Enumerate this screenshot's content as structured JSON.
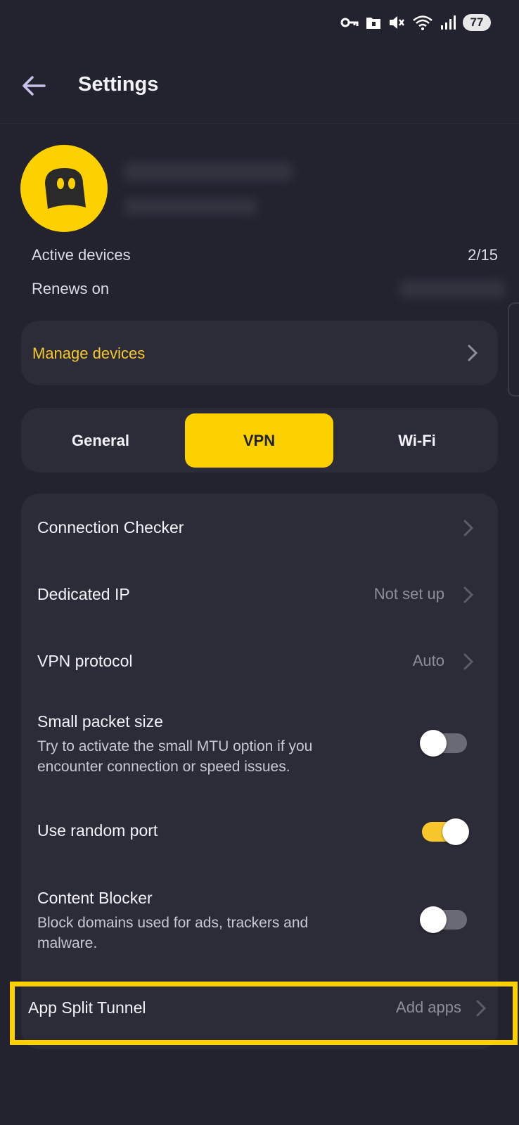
{
  "status_bar": {
    "battery": "77"
  },
  "app_bar": {
    "title": "Settings"
  },
  "account": {
    "active_devices_label": "Active devices",
    "active_devices_value": "2/15",
    "renews_label": "Renews on"
  },
  "manage_devices": {
    "label": "Manage devices"
  },
  "tabs": {
    "general": "General",
    "vpn": "VPN",
    "wifi": "Wi-Fi",
    "selected": "VPN"
  },
  "vpn_settings": {
    "connection_checker": {
      "title": "Connection Checker"
    },
    "dedicated_ip": {
      "title": "Dedicated IP",
      "value": "Not set up"
    },
    "vpn_protocol": {
      "title": "VPN protocol",
      "value": "Auto"
    },
    "small_packet": {
      "title": "Small packet size",
      "subtitle": "Try to activate the small MTU option if you encounter connection or speed issues.",
      "enabled": false
    },
    "random_port": {
      "title": "Use random port",
      "enabled": true
    },
    "content_blocker": {
      "title": "Content Blocker",
      "subtitle": "Block domains used for ads, trackers and malware.",
      "enabled": false
    },
    "app_split_tunnel": {
      "title": "App Split Tunnel",
      "value": "Add apps"
    }
  },
  "colors": {
    "background": "#23232f",
    "card": "#2c2c39",
    "accent": "#fdd000",
    "accent_text": "#f7c72b",
    "highlight_border": "#fdd000"
  }
}
